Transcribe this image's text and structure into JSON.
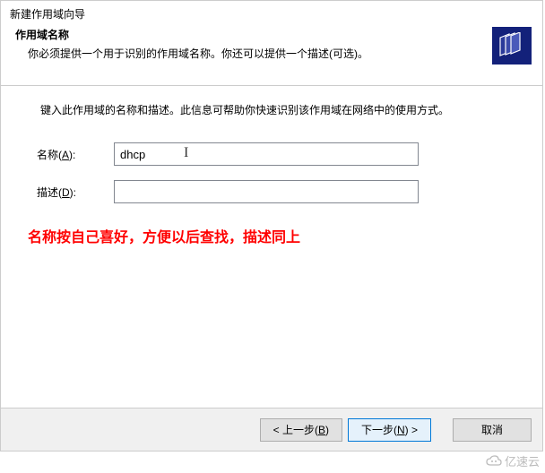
{
  "window": {
    "title": "新建作用域向导"
  },
  "header": {
    "title": "作用域名称",
    "description": "你必须提供一个用于识别的作用域名称。你还可以提供一个描述(可选)。"
  },
  "content": {
    "intro": "键入此作用域的名称和描述。此信息可帮助你快速识别该作用域在网络中的使用方式。"
  },
  "form": {
    "name_label_prefix": "名称(",
    "name_label_key": "A",
    "name_label_suffix": "):",
    "name_value": "dhcp",
    "desc_label_prefix": "描述(",
    "desc_label_key": "D",
    "desc_label_suffix": "):",
    "desc_value": ""
  },
  "annotation": "名称按自己喜好，方便以后查找，描述同上",
  "buttons": {
    "back_prefix": "< 上一步(",
    "back_key": "B",
    "back_suffix": ")",
    "next_prefix": "下一步(",
    "next_key": "N",
    "next_suffix": ") >",
    "cancel": "取消"
  },
  "watermark": "亿速云"
}
